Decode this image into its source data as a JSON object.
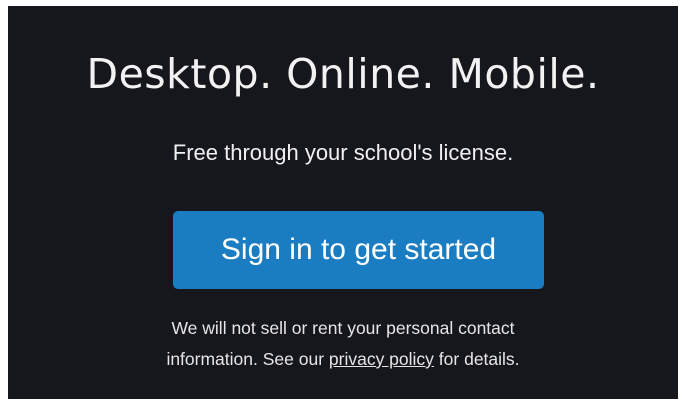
{
  "promo": {
    "headline": "Desktop. Online. Mobile.",
    "subheadline": "Free through your school's license.",
    "signin_label": "Sign in to get started",
    "disclaimer_line1": "We will not sell or rent your personal contact",
    "disclaimer_line2_before": "information. See our ",
    "privacy_link": "privacy policy",
    "disclaimer_line2_after": " for details."
  },
  "colors": {
    "background": "#16171c",
    "button": "#1a7dc2",
    "text": "#f2f2f2"
  }
}
